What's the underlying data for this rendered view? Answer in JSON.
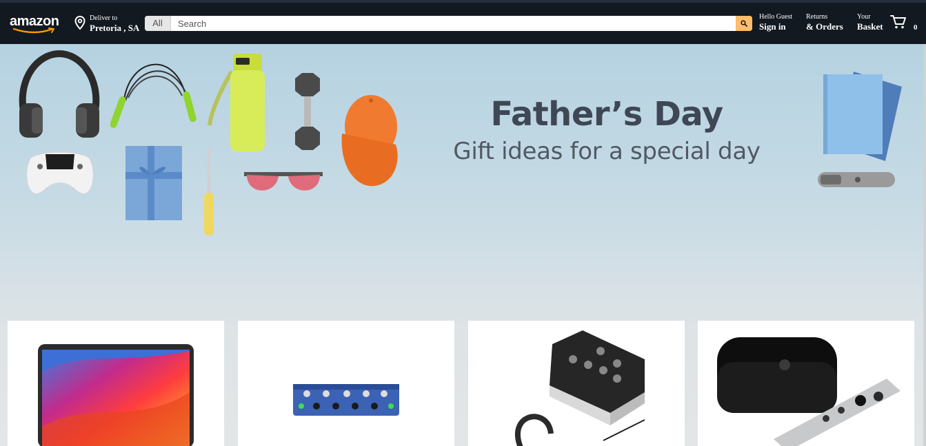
{
  "header": {
    "logo_text": "amazon",
    "deliver_label": "Deliver to",
    "deliver_location": "Pretoria , SA",
    "search_category": "All",
    "search_placeholder": "Search",
    "greeting": "Hello Guest",
    "sign_in": "Sign in",
    "returns": "Returns",
    "orders": "& Orders",
    "your": "Your",
    "basket": "Basket",
    "basket_count": "0"
  },
  "hero": {
    "title": "Father’s Day",
    "subtitle": "Gift ideas for a special day"
  },
  "colors": {
    "header_bg": "#131921",
    "search_button": "#febd69",
    "page_bg": "#e3e6e6"
  },
  "icons": [
    "location-pin-icon",
    "search-icon",
    "cart-icon"
  ],
  "products": [
    {
      "image": "laptop"
    },
    {
      "image": "headphone-amplifier"
    },
    {
      "image": "audio-interface-with-headphones"
    },
    {
      "image": "streaming-box-with-remote"
    }
  ]
}
